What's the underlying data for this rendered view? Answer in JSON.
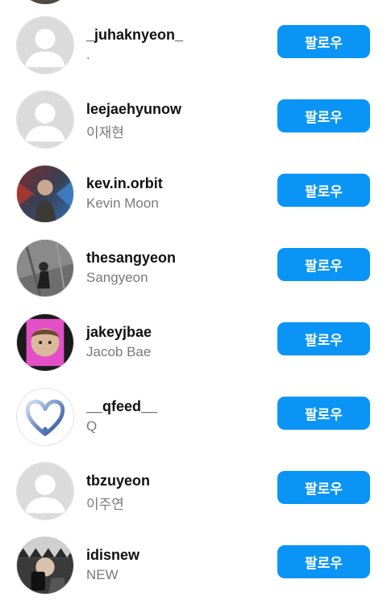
{
  "follow_label": "팔로우",
  "users": [
    {
      "username": "_juhaknyeon_",
      "full_name": ".",
      "avatar": "default-avatar-icon"
    },
    {
      "username": "leejaehyunow",
      "full_name": "이재현",
      "avatar": "default-avatar-icon"
    },
    {
      "username": "kev.in.orbit",
      "full_name": "Kevin Moon",
      "avatar": "profile-photo"
    },
    {
      "username": "thesangyeon",
      "full_name": "Sangyeon",
      "avatar": "profile-photo"
    },
    {
      "username": "jakeyjbae",
      "full_name": "Jacob Bae",
      "avatar": "profile-photo"
    },
    {
      "username": "__qfeed__",
      "full_name": "Q",
      "avatar": "chrome-heart-logo"
    },
    {
      "username": "tbzuyeon",
      "full_name": "이주연",
      "avatar": "default-avatar-icon"
    },
    {
      "username": "idisnew",
      "full_name": "NEW",
      "avatar": "profile-photo"
    }
  ],
  "colors": {
    "follow_button": "#0a95f6",
    "username": "#111111",
    "full_name": "#7a7a7a"
  }
}
